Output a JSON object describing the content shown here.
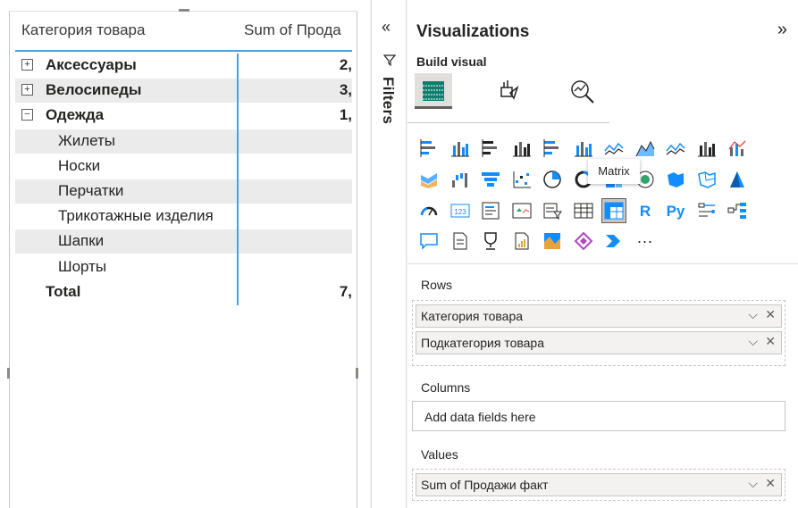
{
  "matrix": {
    "header": {
      "col1": "Категория товара",
      "col2": "Sum of Прода"
    },
    "rows": [
      {
        "toggle": "+",
        "label": "Аксессуары",
        "value": "2,",
        "bold": true,
        "shade": false
      },
      {
        "toggle": "+",
        "label": "Велосипеды",
        "value": "3,",
        "bold": true,
        "shade": true
      },
      {
        "toggle": "−",
        "label": "Одежда",
        "value": "1,",
        "bold": true,
        "shade": false
      },
      {
        "label": "Жилеты",
        "value": "",
        "shade": true
      },
      {
        "label": "Носки",
        "value": "",
        "shade": false
      },
      {
        "label": "Перчатки",
        "value": "",
        "shade": true
      },
      {
        "label": "Трикотажные изделия",
        "value": "",
        "shade": false
      },
      {
        "label": "Шапки",
        "value": "",
        "shade": true
      },
      {
        "label": "Шорты",
        "value": "",
        "shade": false
      }
    ],
    "total": {
      "label": "Total",
      "value": "7,"
    }
  },
  "filters": {
    "collapse_icon": "«",
    "label": "Filters",
    "icon": "filter-icon"
  },
  "viz": {
    "title": "Visualizations",
    "expand_icon": "»",
    "build_label": "Build visual",
    "tooltip": "Matrix",
    "more": "···",
    "rows_header": "Rows",
    "rows_fields": [
      "Категория товара",
      "Подкатегория товара"
    ],
    "columns_header": "Columns",
    "columns_placeholder": "Add data fields here",
    "values_header": "Values",
    "values_fields": [
      "Sum of Продажи факт"
    ],
    "chevron": "⌵",
    "close": "✕"
  },
  "colors": {
    "accent": "#4aa3df",
    "icon_blue": "#118dff",
    "icon_dark": "#252423"
  }
}
